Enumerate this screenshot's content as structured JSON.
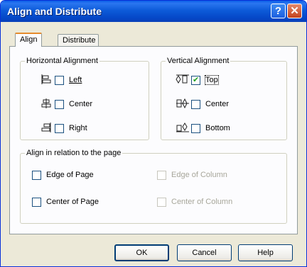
{
  "window": {
    "title": "Align and Distribute"
  },
  "title_buttons": {
    "help": "?",
    "close": "✕"
  },
  "tabs": [
    {
      "label": "Align",
      "active": true
    },
    {
      "label": "Distribute",
      "active": false
    }
  ],
  "horizontal": {
    "legend": "Horizontal Alignment",
    "options": [
      {
        "label": "Left",
        "checked": false,
        "icon": "align-left-icon"
      },
      {
        "label": "Center",
        "checked": false,
        "icon": "align-center-icon"
      },
      {
        "label": "Right",
        "checked": false,
        "icon": "align-right-icon"
      }
    ]
  },
  "vertical": {
    "legend": "Vertical Alignment",
    "options": [
      {
        "label": "Top",
        "checked": true,
        "icon": "align-top-icon"
      },
      {
        "label": "Center",
        "checked": false,
        "icon": "align-middle-icon"
      },
      {
        "label": "Bottom",
        "checked": false,
        "icon": "align-bottom-icon"
      }
    ]
  },
  "relation": {
    "legend": "Align in relation to the page",
    "edge_of_page": "Edge of Page",
    "center_of_page": "Center of Page",
    "edge_of_column": "Edge of Column",
    "center_of_column": "Center of Column"
  },
  "buttons": {
    "ok": "OK",
    "cancel": "Cancel",
    "help": "Help"
  },
  "colors": {
    "titlebar": "#0a5ee8",
    "dialog_bg": "#ece9d8",
    "close_button": "#c4421c"
  }
}
